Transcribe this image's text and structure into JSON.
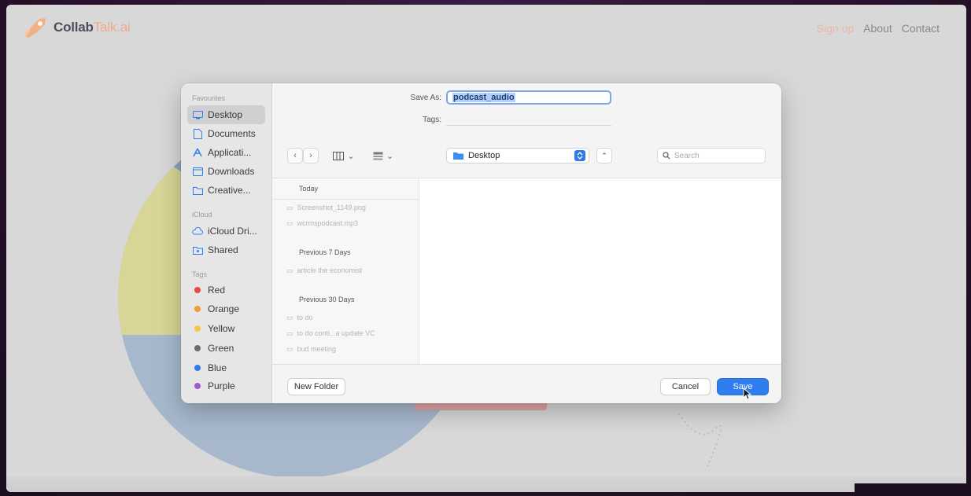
{
  "site": {
    "logo_main": "Collab",
    "logo_accent": "Talk.ai",
    "nav": [
      "Sign up",
      "About",
      "Contact"
    ]
  },
  "dialog": {
    "save_as_label": "Save As:",
    "save_as_value": "podcast_audio",
    "tags_label": "Tags:",
    "location": "Desktop",
    "search_placeholder": "Search",
    "sidebar": {
      "favourites_header": "Favourites",
      "favourites": [
        {
          "label": "Desktop",
          "icon": "desktop-icon",
          "selected": true
        },
        {
          "label": "Documents",
          "icon": "document-icon"
        },
        {
          "label": "Applicati...",
          "icon": "applications-icon"
        },
        {
          "label": "Downloads",
          "icon": "downloads-icon"
        },
        {
          "label": "Creative...",
          "icon": "folder-icon"
        }
      ],
      "icloud_header": "iCloud",
      "icloud": [
        {
          "label": "iCloud Dri...",
          "icon": "cloud-icon"
        },
        {
          "label": "Shared",
          "icon": "shared-folder-icon"
        }
      ],
      "tags_header": "Tags",
      "tags": [
        {
          "label": "Red",
          "color": "#ea4a3c"
        },
        {
          "label": "Orange",
          "color": "#f29a38"
        },
        {
          "label": "Yellow",
          "color": "#f4c943"
        },
        {
          "label": "Green",
          "color": "#6b6b6b"
        },
        {
          "label": "Blue",
          "color": "#2f7ef0"
        },
        {
          "label": "Purple",
          "color": "#9d5cc9"
        }
      ]
    },
    "files": {
      "today_header": "Today",
      "today": [
        "Screenshot_1149.png",
        "wcrmspodcast.mp3"
      ],
      "prev7_header": "Previous 7 Days",
      "prev7": [
        "article the economist"
      ],
      "prev30_header": "Previous 30 Days",
      "prev30": [
        "to do",
        "to do conti...a update VC",
        "bud meeting"
      ]
    },
    "buttons": {
      "new_folder": "New Folder",
      "cancel": "Cancel",
      "save": "Save"
    }
  },
  "colors": {
    "accent_blue": "#2f7ef0",
    "logo_accent": "#f1a98e",
    "background_frame": "#2a1430"
  }
}
